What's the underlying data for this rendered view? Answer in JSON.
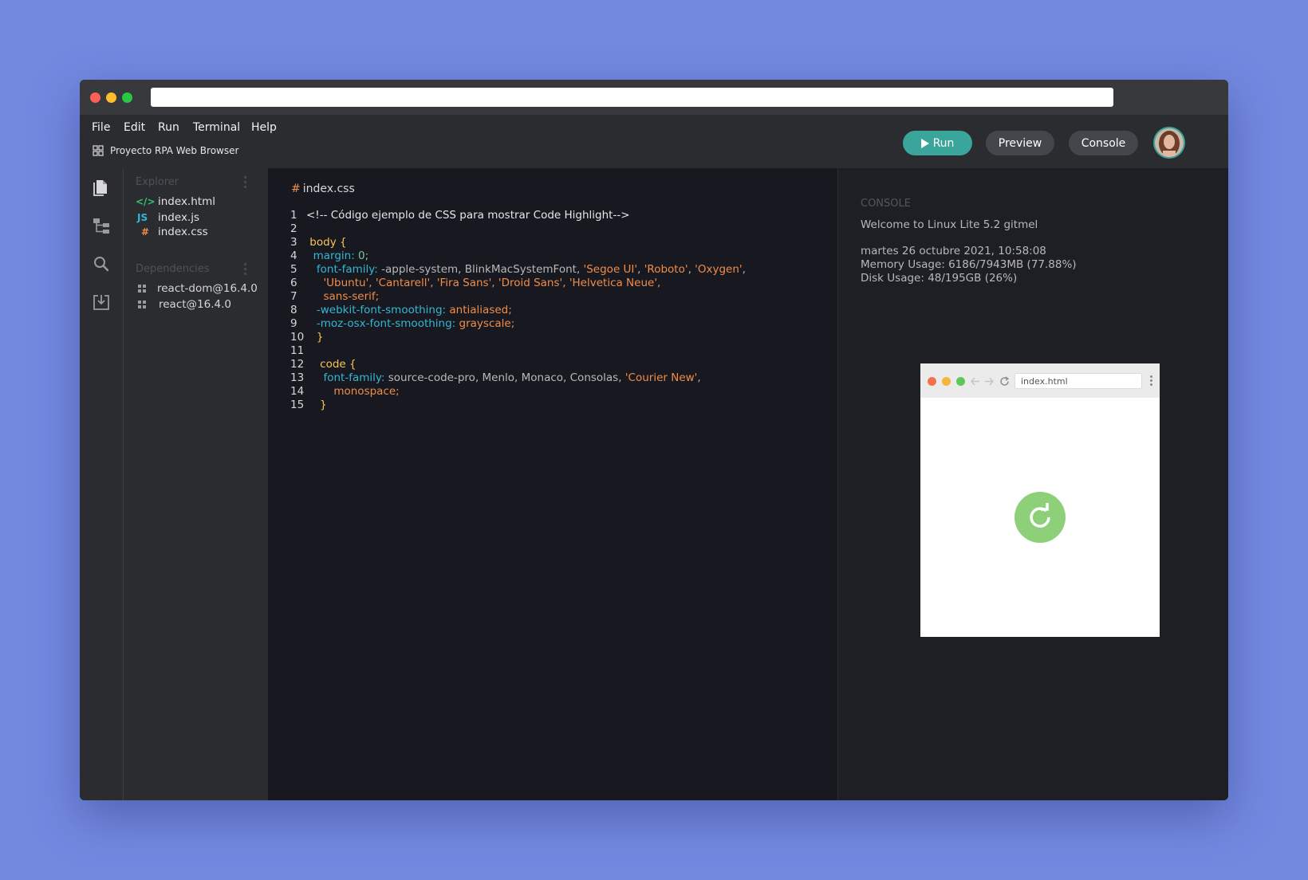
{
  "window": {
    "url": ""
  },
  "menu": [
    "File",
    "Edit",
    "Run",
    "Terminal",
    "Help"
  ],
  "project": {
    "name": "Proyecto RPA Web Browser",
    "icon": "grid-icon"
  },
  "toolbar": {
    "run_label": "Run",
    "preview_label": "Preview",
    "console_label": "Console"
  },
  "activity_bar": [
    "files-icon",
    "tree-icon",
    "search-icon",
    "download-icon"
  ],
  "explorer": {
    "title": "Explorer",
    "files": [
      {
        "icon": "</>",
        "name": "index.html"
      },
      {
        "icon": "JS",
        "name": "index.js"
      },
      {
        "icon": "#",
        "name": "index.css"
      }
    ]
  },
  "dependencies": {
    "title": "Dependencies",
    "items": [
      "react-dom@16.4.0",
      "react@16.4.0"
    ]
  },
  "editor": {
    "tab": "index.css",
    "tab_icon": "#",
    "lines": [
      {
        "n": "1",
        "t": "<!-- Código ejemplo de CSS para mostrar Code Highlight-->"
      },
      {
        "n": "2",
        "t": ""
      },
      {
        "n": "3",
        "t": "body {"
      },
      {
        "n": "4",
        "t": "margin: 0;"
      },
      {
        "n": "5",
        "t": "font-family: -apple-system, BlinkMacSystemFont, 'Segoe UI', 'Roboto', 'Oxygen',"
      },
      {
        "n": "6",
        "t": "'Ubuntu', 'Cantarell', 'Fira Sans', 'Droid Sans', 'Helvetica Neue',"
      },
      {
        "n": "7",
        "t": "sans-serif;"
      },
      {
        "n": "8",
        "t": "-webkit-font-smoothing: antialiased;"
      },
      {
        "n": "9",
        "t": "-moz-osx-font-smoothing: grayscale;"
      },
      {
        "n": "10",
        "t": "}"
      },
      {
        "n": "11",
        "t": ""
      },
      {
        "n": "12",
        "t": "code {"
      },
      {
        "n": "13",
        "t": "font-family: source-code-pro, Menlo, Monaco, Consolas, 'Courier New',"
      },
      {
        "n": "14",
        "t": "monospace;"
      },
      {
        "n": "15",
        "t": "}"
      }
    ]
  },
  "console": {
    "title": "CONSOLE",
    "welcome": "Welcome to Linux Lite 5.2 gitmel",
    "date": "martes 26 octubre 2021, 10:58:08",
    "memory": "Memory Usage: 6186/7943MB (77.88%)",
    "disk": "Disk Usage: 48/195GB (26%)"
  },
  "preview": {
    "url": "index.html",
    "reload_icon": "reload-icon"
  },
  "colors": {
    "accent": "#3aa59a",
    "background": "#7389e0",
    "reload": "#8ed07a"
  }
}
